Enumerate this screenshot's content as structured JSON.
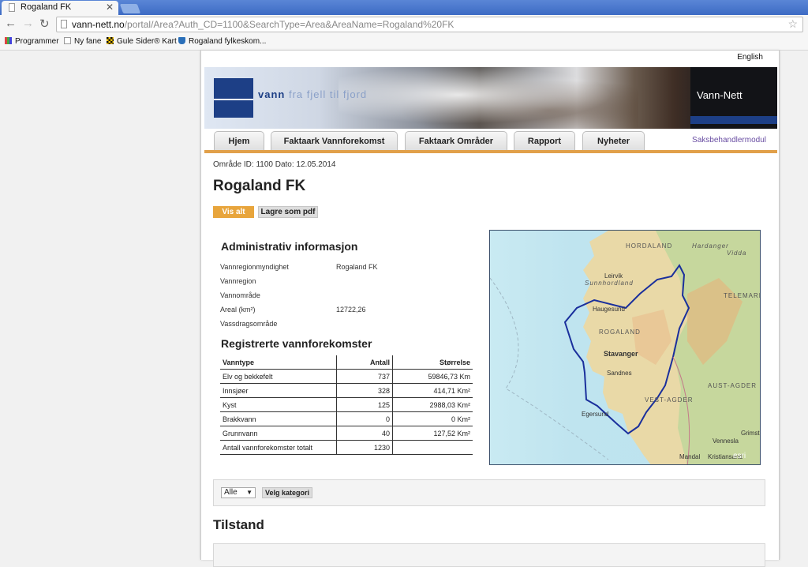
{
  "browser": {
    "tab_title": "Rogaland FK",
    "url_host": "vann-nett.no",
    "url_path": "/portal/Area?Auth_CD=1100&SearchType=Area&AreaName=Rogaland%20FK",
    "bookmarks": [
      "Programmer",
      "Ny fane",
      "Gule Sider® Kart",
      "Rogaland fylkeskom..."
    ]
  },
  "page": {
    "language_link": "English",
    "banner": {
      "slogan_bold": "vann",
      "slogan_rest": "fra fjell til fjord",
      "site_name": "Vann-Nett"
    },
    "nav": [
      "Hjem",
      "Faktaark Vannforekomst",
      "Faktaark Områder",
      "Rapport",
      "Nyheter"
    ],
    "saksbehandler_link": "Saksbehandlermodul",
    "meta": "Område ID: 1100 Dato: 12.05.2014",
    "title": "Rogaland FK",
    "buttons": {
      "vis_alt": "Vis alt",
      "lagre_pdf": "Lagre som pdf"
    },
    "admin": {
      "heading": "Administrativ informasjon",
      "rows": [
        {
          "label": "Vannregionmyndighet",
          "value": "Rogaland FK"
        },
        {
          "label": "Vannregion",
          "value": ""
        },
        {
          "label": "Vannområde",
          "value": ""
        },
        {
          "label": "Areal (km²)",
          "value": "12722,26"
        },
        {
          "label": "Vassdragsområde",
          "value": ""
        }
      ]
    },
    "registered": {
      "heading": "Registrerte vannforekomster",
      "columns": [
        "Vanntype",
        "Antall",
        "Størrelse"
      ],
      "rows": [
        {
          "type": "Elv og bekkefelt",
          "count": "737",
          "size": "59846,73 Km"
        },
        {
          "type": "Innsjøer",
          "count": "328",
          "size": "414,71 Km²"
        },
        {
          "type": "Kyst",
          "count": "125",
          "size": "2988,03 Km²"
        },
        {
          "type": "Brakkvann",
          "count": "0",
          "size": "0 Km²"
        },
        {
          "type": "Grunnvann",
          "count": "40",
          "size": "127,52 Km²"
        },
        {
          "type": "Antall vannforekomster totalt",
          "count": "1230",
          "size": ""
        }
      ]
    },
    "map": {
      "labels": [
        "HORDALAND",
        "Hardanger",
        "Sunnhordland",
        "ROGALAND",
        "TELEMARK",
        "AUST-AGDER",
        "VEST-AGDER",
        "Vidda"
      ],
      "cities": [
        "Stavanger",
        "Haugesund",
        "Egersund",
        "Sandnes",
        "Leirvik",
        "Mandal",
        "Kristiansand",
        "Vennesla",
        "Grimst"
      ],
      "attribution": "esri"
    },
    "filter": {
      "select_value": "Alle",
      "button": "Velg kategori"
    },
    "tilstand_heading": "Tilstand"
  }
}
